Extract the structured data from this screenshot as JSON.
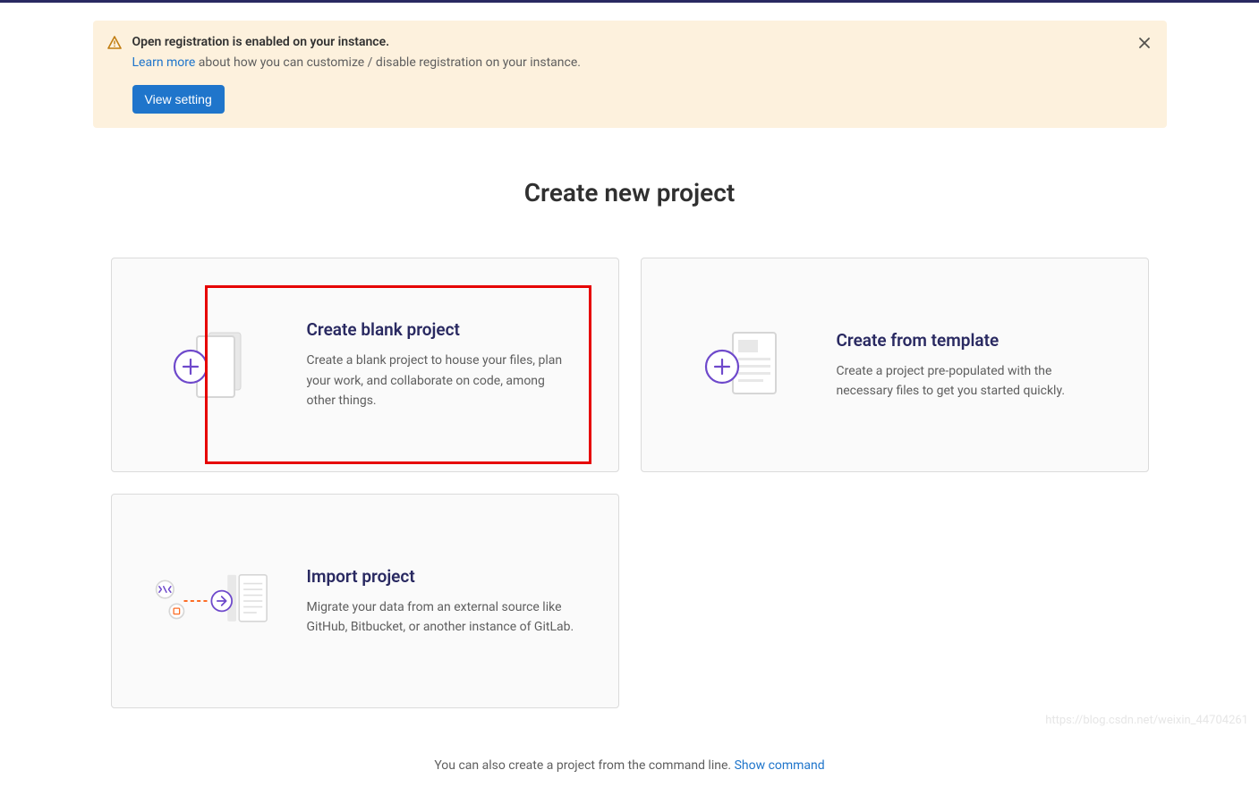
{
  "alert": {
    "title": "Open registration is enabled on your instance.",
    "link_text": "Learn more",
    "rest_text": " about how you can customize / disable registration on your instance.",
    "button_label": "View setting"
  },
  "page": {
    "title": "Create new project"
  },
  "cards": {
    "blank": {
      "title": "Create blank project",
      "desc": "Create a blank project to house your files, plan your work, and collaborate on code, among other things."
    },
    "template": {
      "title": "Create from template",
      "desc": "Create a project pre-populated with the necessary files to get you started quickly."
    },
    "import": {
      "title": "Import project",
      "desc": "Migrate your data from an external source like GitHub, Bitbucket, or another instance of GitLab."
    }
  },
  "footer": {
    "text": "You can also create a project from the command line. ",
    "link_text": "Show command"
  },
  "watermark": "https://blog.csdn.net/weixin_44704261"
}
